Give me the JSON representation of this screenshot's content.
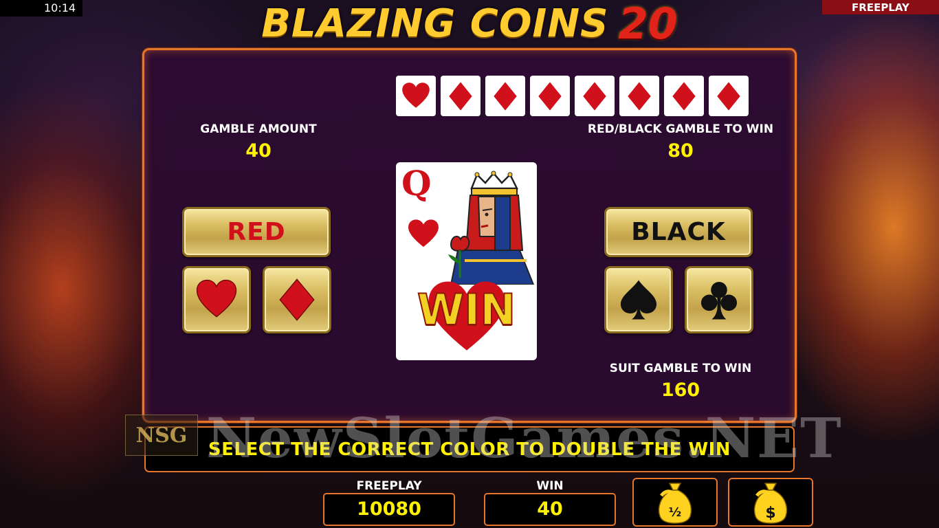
{
  "status": {
    "clock": "10:14",
    "mode": "FREEPLAY"
  },
  "title": {
    "text": "BLAZING COINS",
    "number": "20"
  },
  "history": {
    "icons": [
      "heart-icon",
      "diamond-icon",
      "diamond-icon",
      "diamond-icon",
      "diamond-icon",
      "diamond-icon",
      "diamond-icon",
      "diamond-icon"
    ]
  },
  "gamble_amount": {
    "label": "GAMBLE AMOUNT",
    "value": "40"
  },
  "red_black": {
    "label": "RED/BLACK GAMBLE TO WIN",
    "value": "80"
  },
  "suit_gamble": {
    "label": "SUIT GAMBLE TO WIN",
    "value": "160"
  },
  "buttons": {
    "red": "RED",
    "black": "BLACK"
  },
  "card": {
    "rank": "Q",
    "suit": "heart",
    "overlay": "WIN"
  },
  "message": "SELECT THE CORRECT COLOR TO DOUBLE THE WIN",
  "watermark": {
    "text": "NewSlotGames.NET",
    "logo": "NSG"
  },
  "meters": {
    "freeplay": {
      "label": "FREEPLAY",
      "value": "10080"
    },
    "win": {
      "label": "WIN",
      "value": "40"
    }
  },
  "colors": {
    "red": "#d0101a",
    "accent": "#e6762a",
    "gold": "#d9bd62",
    "value_yellow": "#fff200"
  }
}
